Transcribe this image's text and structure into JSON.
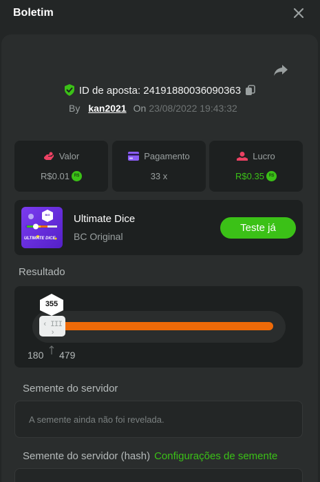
{
  "header": {
    "title": "Boletim"
  },
  "bet": {
    "id_text": "ID de aposta: 24191880036090363",
    "by_label": "By",
    "user": "kan2021",
    "on_label": "On",
    "date": "23/08/2022 19:43:32"
  },
  "stats": [
    {
      "label": "Valor",
      "value": "R$0.01",
      "coin": "R$",
      "icon": "bet-hand-icon",
      "color": "#ed4163"
    },
    {
      "label": "Pagamento",
      "value": "33 x",
      "icon": "card-icon",
      "color": "#8a5cf6"
    },
    {
      "label": "Lucro",
      "value": "R$0.35",
      "coin": "R$",
      "icon": "profit-hand-icon",
      "color": "#ed4163",
      "value_color": "#3bc117"
    }
  ],
  "game": {
    "name": "Ultimate Dice",
    "subtitle": "BC Original",
    "play_label": "Teste já",
    "thumb_label": "ULTIMATE DICE",
    "thumb_badge": "BIG",
    "thumb_color": "#7b3cf0"
  },
  "result": {
    "label": "Resultado",
    "value": "355",
    "range_low": "180",
    "range_high": "479",
    "handle_glyph": "‹ III ›",
    "bar_color": "#ee6a08"
  },
  "server_seed": {
    "label": "Semente do servidor",
    "placeholder": "A semente ainda não foi revelada."
  },
  "hash": {
    "label": "Semente do servidor (hash)",
    "link": "Configurações de semente"
  },
  "colors": {
    "accent": "#3bc117",
    "background": "#232626",
    "panel": "#2a2d2d",
    "card": "#1d2020"
  }
}
